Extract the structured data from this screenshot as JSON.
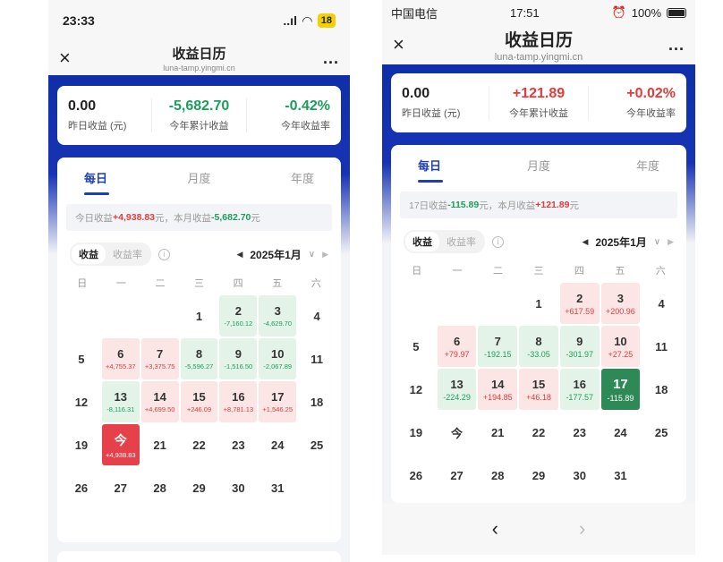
{
  "left": {
    "status": {
      "time": "23:33",
      "signal": "..ıl",
      "battery": "18"
    },
    "nav": {
      "close": "×",
      "title": "收益日历",
      "subtitle": "luna-tamp.yingmi.cn",
      "more": "..."
    },
    "summary": [
      {
        "value": "0.00",
        "label": "昨日收益 (元)"
      },
      {
        "value": "-5,682.70",
        "label": "今年累计收益"
      },
      {
        "value": "-0.42%",
        "label": "今年收益率"
      }
    ],
    "tabs": [
      "每日",
      "月度",
      "年度"
    ],
    "info": {
      "p1": "今日收益 ",
      "v1": "+4,938.83",
      "p2": " 元，本月收益 ",
      "v2": "-5,682.70",
      "p3": " 元"
    },
    "seg": [
      "收益",
      "收益率"
    ],
    "month": "2025年1月",
    "weekdays": [
      "日",
      "一",
      "二",
      "三",
      "四",
      "五",
      "六"
    ],
    "days": [
      {
        "d": "",
        "a": "",
        "t": ""
      },
      {
        "d": "",
        "a": "",
        "t": ""
      },
      {
        "d": "",
        "a": "",
        "t": ""
      },
      {
        "d": "1",
        "a": "",
        "t": ""
      },
      {
        "d": "2",
        "a": "-7,160.12",
        "t": "neg"
      },
      {
        "d": "3",
        "a": "-4,629.70",
        "t": "neg"
      },
      {
        "d": "4",
        "a": "",
        "t": ""
      },
      {
        "d": "5",
        "a": "",
        "t": ""
      },
      {
        "d": "6",
        "a": "+4,755.37",
        "t": "pos"
      },
      {
        "d": "7",
        "a": "+3,375.75",
        "t": "pos"
      },
      {
        "d": "8",
        "a": "-5,596.27",
        "t": "neg"
      },
      {
        "d": "9",
        "a": "-1,516.50",
        "t": "neg"
      },
      {
        "d": "10",
        "a": "-2,067.89",
        "t": "neg"
      },
      {
        "d": "11",
        "a": "",
        "t": ""
      },
      {
        "d": "12",
        "a": "",
        "t": ""
      },
      {
        "d": "13",
        "a": "-8,116.31",
        "t": "neg"
      },
      {
        "d": "14",
        "a": "+4,699.50",
        "t": "pos"
      },
      {
        "d": "15",
        "a": "+246.09",
        "t": "pos"
      },
      {
        "d": "16",
        "a": "+8,781.13",
        "t": "pos"
      },
      {
        "d": "17",
        "a": "+1,546.25",
        "t": "pos"
      },
      {
        "d": "18",
        "a": "",
        "t": ""
      },
      {
        "d": "19",
        "a": "",
        "t": ""
      },
      {
        "d": "今",
        "a": "+4,938.83",
        "t": "today-red"
      },
      {
        "d": "21",
        "a": "",
        "t": ""
      },
      {
        "d": "22",
        "a": "",
        "t": ""
      },
      {
        "d": "23",
        "a": "",
        "t": ""
      },
      {
        "d": "24",
        "a": "",
        "t": ""
      },
      {
        "d": "25",
        "a": "",
        "t": ""
      },
      {
        "d": "26",
        "a": "",
        "t": ""
      },
      {
        "d": "27",
        "a": "",
        "t": ""
      },
      {
        "d": "28",
        "a": "",
        "t": ""
      },
      {
        "d": "29",
        "a": "",
        "t": ""
      },
      {
        "d": "30",
        "a": "",
        "t": ""
      },
      {
        "d": "31",
        "a": "",
        "t": ""
      }
    ]
  },
  "right": {
    "status": {
      "carrier": "中国电信",
      "time": "17:51",
      "battery": "100%"
    },
    "nav": {
      "close": "×",
      "title": "收益日历",
      "subtitle": "luna-tamp.yingmi.cn",
      "more": "..."
    },
    "summary": [
      {
        "value": "0.00",
        "label": "昨日收益 (元)"
      },
      {
        "value": "+121.89",
        "label": "今年累计收益"
      },
      {
        "value": "+0.02%",
        "label": "今年收益率"
      }
    ],
    "tabs": [
      "每日",
      "月度",
      "年度"
    ],
    "info": {
      "p1": "17日收益 ",
      "v1": "-115.89",
      "p2": " 元，本月收益 ",
      "v2": "+121.89",
      "p3": " 元"
    },
    "seg": [
      "收益",
      "收益率"
    ],
    "month": "2025年1月",
    "weekdays": [
      "日",
      "一",
      "二",
      "三",
      "四",
      "五",
      "六"
    ],
    "days": [
      {
        "d": "",
        "a": "",
        "t": ""
      },
      {
        "d": "",
        "a": "",
        "t": ""
      },
      {
        "d": "",
        "a": "",
        "t": ""
      },
      {
        "d": "1",
        "a": "",
        "t": ""
      },
      {
        "d": "2",
        "a": "+617.59",
        "t": "pos"
      },
      {
        "d": "3",
        "a": "+200.96",
        "t": "pos"
      },
      {
        "d": "4",
        "a": "",
        "t": ""
      },
      {
        "d": "5",
        "a": "",
        "t": ""
      },
      {
        "d": "6",
        "a": "+79.97",
        "t": "pos"
      },
      {
        "d": "7",
        "a": "-192.15",
        "t": "neg"
      },
      {
        "d": "8",
        "a": "-33.05",
        "t": "neg"
      },
      {
        "d": "9",
        "a": "-301.97",
        "t": "neg"
      },
      {
        "d": "10",
        "a": "+27.25",
        "t": "pos"
      },
      {
        "d": "11",
        "a": "",
        "t": ""
      },
      {
        "d": "12",
        "a": "",
        "t": ""
      },
      {
        "d": "13",
        "a": "-224.29",
        "t": "neg"
      },
      {
        "d": "14",
        "a": "+194.85",
        "t": "pos"
      },
      {
        "d": "15",
        "a": "+46.18",
        "t": "pos"
      },
      {
        "d": "16",
        "a": "-177.57",
        "t": "neg"
      },
      {
        "d": "17",
        "a": "-115.89",
        "t": "sel-green"
      },
      {
        "d": "18",
        "a": "",
        "t": ""
      },
      {
        "d": "19",
        "a": "",
        "t": ""
      },
      {
        "d": "今",
        "a": "",
        "t": ""
      },
      {
        "d": "21",
        "a": "",
        "t": ""
      },
      {
        "d": "22",
        "a": "",
        "t": ""
      },
      {
        "d": "23",
        "a": "",
        "t": ""
      },
      {
        "d": "24",
        "a": "",
        "t": ""
      },
      {
        "d": "25",
        "a": "",
        "t": ""
      },
      {
        "d": "26",
        "a": "",
        "t": ""
      },
      {
        "d": "27",
        "a": "",
        "t": ""
      },
      {
        "d": "28",
        "a": "",
        "t": ""
      },
      {
        "d": "29",
        "a": "",
        "t": ""
      },
      {
        "d": "30",
        "a": "",
        "t": ""
      },
      {
        "d": "31",
        "a": "",
        "t": ""
      }
    ],
    "bottom": {
      "back": "‹",
      "forward": "›"
    }
  }
}
